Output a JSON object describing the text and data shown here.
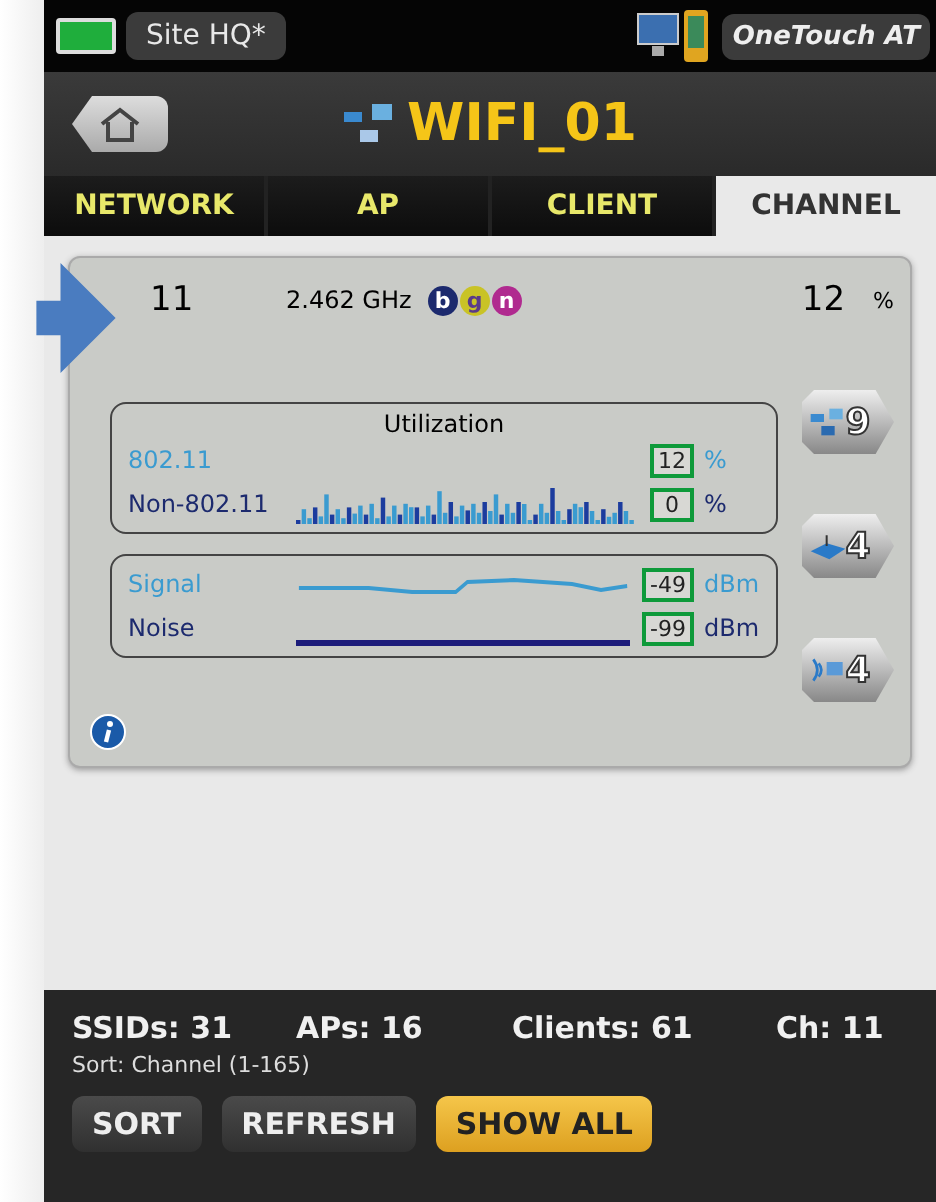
{
  "top_bar": {
    "site": "Site HQ*",
    "device": "OneTouch AT"
  },
  "header": {
    "title": "WIFI_01"
  },
  "tabs": [
    {
      "label": "NETWORK",
      "selected": false
    },
    {
      "label": "AP",
      "selected": false
    },
    {
      "label": "CLIENT",
      "selected": false
    },
    {
      "label": "CHANNEL",
      "selected": true
    }
  ],
  "channel_card": {
    "channel": "11",
    "frequency": "2.462 GHz",
    "bands": [
      {
        "label": "b",
        "color": "#1c2a6e"
      },
      {
        "label": "g",
        "color": "#c9c326"
      },
      {
        "label": "n",
        "color": "#b02a8f"
      }
    ],
    "usage": "12",
    "usage_unit": "%",
    "utilization": {
      "title": "Utilization",
      "rows": [
        {
          "kind": "wifi",
          "label": "802.11",
          "value": "12",
          "unit": "%"
        },
        {
          "kind": "other",
          "label": "Non-802.11",
          "value": "0",
          "unit": "%"
        }
      ]
    },
    "levels": {
      "rows": [
        {
          "kind": "signal",
          "label": "Signal",
          "value": "-49",
          "unit": "dBm"
        },
        {
          "kind": "noise",
          "label": "Noise",
          "value": "-99",
          "unit": "dBm"
        }
      ]
    },
    "side_buttons": [
      {
        "kind": "network",
        "count": "9"
      },
      {
        "kind": "ap",
        "count": "4"
      },
      {
        "kind": "client",
        "count": "4"
      }
    ]
  },
  "summary": [
    {
      "label": "SSIDs:",
      "value": "31"
    },
    {
      "label": "APs:",
      "value": "16"
    },
    {
      "label": "Clients:",
      "value": "61"
    },
    {
      "label": "Ch:",
      "value": "11"
    }
  ],
  "sort_text": "Sort: Channel (1-165)",
  "buttons": [
    {
      "label": "SORT",
      "selected": false
    },
    {
      "label": "REFRESH",
      "selected": false
    },
    {
      "label": "SHOW ALL",
      "selected": true
    }
  ]
}
